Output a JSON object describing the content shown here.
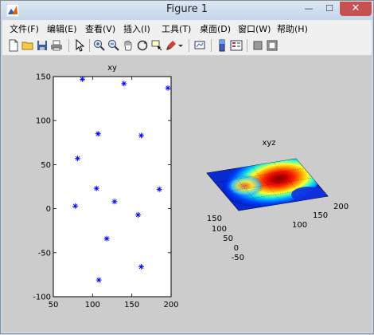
{
  "window": {
    "title": "Figure 1",
    "minimize": "—",
    "maximize": "☐",
    "close": "✕"
  },
  "menu": [
    {
      "label": "文件(F)"
    },
    {
      "label": "编辑(E)"
    },
    {
      "label": "查看(V)"
    },
    {
      "label": "插入(I)"
    },
    {
      "label": "工具(T)"
    },
    {
      "label": "桌面(D)"
    },
    {
      "label": "窗口(W)"
    },
    {
      "label": "帮助(H)"
    }
  ],
  "toolbar_icons": [
    "new-file-icon",
    "open-folder-icon",
    "save-icon",
    "print-icon",
    "pointer-icon",
    "zoom-in-icon",
    "zoom-out-icon",
    "pan-icon",
    "rotate-icon",
    "data-cursor-icon",
    "brush-icon",
    "dropdown-arrow-icon",
    "link-plot-icon",
    "colorbar-icon",
    "legend-icon",
    "hide-tools-icon",
    "show-tools-icon"
  ],
  "colors": {
    "marker": "#0000ff",
    "figure_bg": "#cccccc",
    "axes_bg": "#ffffff"
  },
  "chart_data": [
    {
      "type": "scatter",
      "title": "xy",
      "xlabel": "",
      "ylabel": "",
      "xlim": [
        50,
        200
      ],
      "ylim": [
        -100,
        150
      ],
      "xticks": [
        "50",
        "100",
        "150",
        "200"
      ],
      "yticks": [
        "-100",
        "-50",
        "0",
        "50",
        "100",
        "150"
      ],
      "marker": "*",
      "x": [
        87,
        140,
        196,
        107,
        162,
        81,
        105,
        185,
        78,
        128,
        158,
        118,
        162,
        108
      ],
      "y": [
        147,
        142,
        137,
        85,
        83,
        57,
        23,
        22,
        3,
        8,
        -7,
        -34,
        -66,
        -81
      ]
    },
    {
      "type": "heatmap",
      "title": "xyz",
      "xticks": [
        "100",
        "150",
        "200"
      ],
      "yticks": [
        "-50",
        "0",
        "50",
        "100",
        "150"
      ],
      "grid": true
    }
  ]
}
